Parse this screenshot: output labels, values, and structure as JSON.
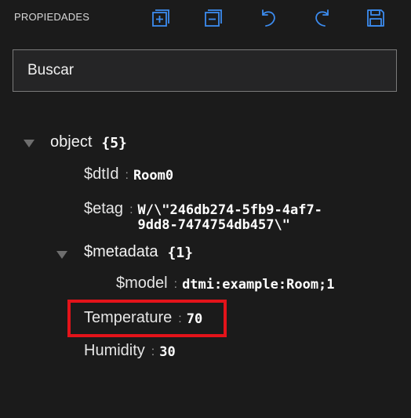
{
  "panel": {
    "title": "PROPIEDADES"
  },
  "toolbar": [
    {
      "name": "expand-all-button",
      "icon": "expand-all-icon"
    },
    {
      "name": "collapse-all-button",
      "icon": "collapse-all-icon"
    },
    {
      "name": "undo-button",
      "icon": "undo-icon"
    },
    {
      "name": "redo-button",
      "icon": "redo-icon"
    },
    {
      "name": "save-button",
      "icon": "save-icon"
    }
  ],
  "colors": {
    "accent": "#3c8cf0",
    "highlight": "#e3131a"
  },
  "search": {
    "placeholder": "Buscar"
  },
  "tree": {
    "root": {
      "key": "object",
      "count": "{5}"
    },
    "dtid": {
      "key": "$dtId",
      "value": "Room0"
    },
    "etag": {
      "key": "$etag",
      "value_line1": "W/\\\"246db274-5fb9-4af7-",
      "value_line2": "9dd8-7474754db457\\\""
    },
    "metadata": {
      "key": "$metadata",
      "count": "{1}"
    },
    "model": {
      "key": "$model",
      "value": "dtmi:example:Room;1"
    },
    "temperature": {
      "key": "Temperature",
      "value": "70"
    },
    "humidity": {
      "key": "Humidity",
      "value": "30"
    },
    "separator": ":"
  }
}
